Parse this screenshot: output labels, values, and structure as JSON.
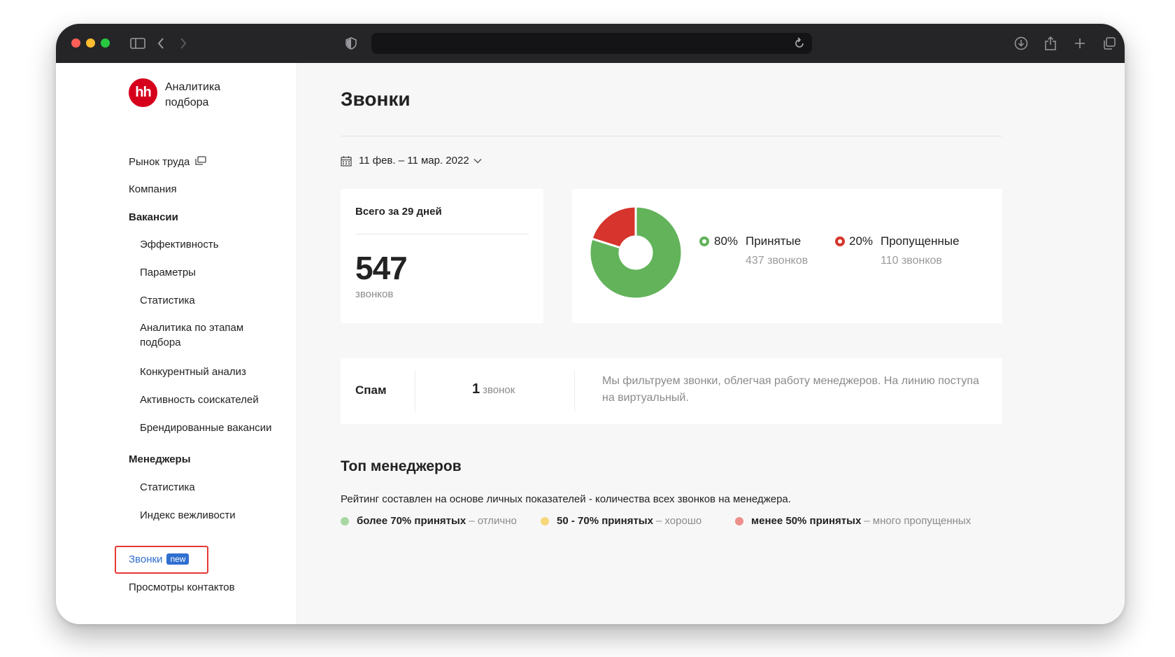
{
  "app": {
    "logo_text": "hh",
    "title": "Аналитика подбора"
  },
  "sidebar": {
    "items": [
      {
        "label": "Рынок труда"
      },
      {
        "label": "Компания"
      },
      {
        "label": "Вакансии"
      },
      {
        "label": "Эффективность"
      },
      {
        "label": "Параметры"
      },
      {
        "label": "Статистика"
      },
      {
        "label": "Аналитика по этапам подбора"
      },
      {
        "label": "Конкурентный анализ"
      },
      {
        "label": "Активность соискателей"
      },
      {
        "label": "Брендированные вакансии"
      },
      {
        "label": "Менеджеры"
      },
      {
        "label": "Статистика"
      },
      {
        "label": "Индекс вежливости"
      },
      {
        "label": "Звонки",
        "badge": "new"
      },
      {
        "label": "Просмотры контактов"
      }
    ]
  },
  "main": {
    "title": "Звонки",
    "date_range": "11 фев. – 11 мар. 2022",
    "total": {
      "title": "Всего за 29 дней",
      "value": "547",
      "unit": "звонков"
    },
    "calls_split": {
      "accepted": {
        "pct": "80%",
        "label": "Принятые",
        "count": "437 звонков",
        "color": "#62b35a"
      },
      "missed": {
        "pct": "20%",
        "label": "Пропущенные",
        "count": "110 звонков",
        "color": "#d6342c"
      }
    },
    "spam": {
      "label": "Спам",
      "count": "1",
      "unit": "звонок",
      "text": "Мы фильтруем звонки, облегчая работу менеджеров. На линию поступа",
      "text2": "на виртуальный."
    },
    "top": {
      "title": "Топ менеджеров",
      "desc": "Рейтинг составлен на основе личных показателей - количества всех звонков на менеджера.",
      "ratings": [
        {
          "label": "более 70% принятых",
          "desc": "– отлично",
          "color": "#a8d8a2"
        },
        {
          "label": "50 - 70% принятых",
          "desc": "– хорошо",
          "color": "#f8d77a"
        },
        {
          "label": "менее 50% принятых",
          "desc": "– много пропущенных",
          "color": "#ee8f8c"
        }
      ]
    }
  },
  "chart_data": {
    "type": "pie",
    "categories": [
      "Принятые",
      "Пропущенные"
    ],
    "values": [
      437,
      110
    ],
    "colors": [
      "#62b35a",
      "#d6342c"
    ]
  }
}
